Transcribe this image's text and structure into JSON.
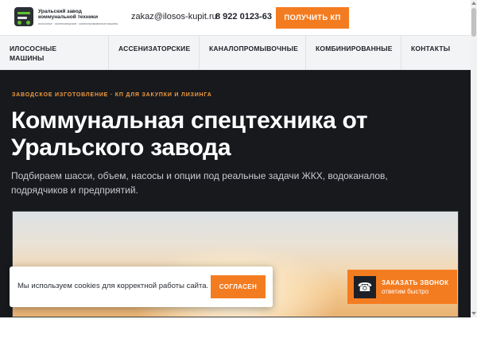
{
  "brand": {
    "name_line1": "Уральский завод",
    "name_line2": "коммунальной техники",
    "tagline": "илососные · ассенизаторские · каналопромывочные машины"
  },
  "header": {
    "email": "zakaz@ilosos-kupit.ru",
    "phone": "8 922 0123-63",
    "cta_label": "ПОЛУЧИТЬ КП"
  },
  "nav": {
    "items": [
      {
        "label": "ИЛОСОСНЫЕ МАШИНЫ"
      },
      {
        "label": "АССЕНИЗАТОРСКИЕ"
      },
      {
        "label": "КАНАЛОПРОМЫВОЧНЫЕ"
      },
      {
        "label": "КОМБИНИРОВАННЫЕ"
      },
      {
        "label": "КОНТАКТЫ"
      }
    ]
  },
  "hero": {
    "eyebrow": "ЗАВОДСКОЕ ИЗГОТОВЛЕНИЕ · КП ДЛЯ ЗАКУПКИ И ЛИЗИНГА",
    "title": "Коммунальная спецтехника от Уральского завода",
    "lead": "Подбираем шасси, объем, насосы и опции под реальные задачи ЖКХ, водоканалов, подрядчиков и предприятий."
  },
  "cookie": {
    "text": "Мы используем cookies для корректной работы сайта.",
    "button": "СОГЛАСЕН"
  },
  "callback": {
    "title": "ЗАКАЗАТЬ ЗВОНОК",
    "subtitle": "ответим быстро",
    "icon": "phone-icon"
  },
  "colors": {
    "accent": "#f47c20",
    "hero_bg": "#17191d",
    "eyebrow": "#f29b3f"
  }
}
